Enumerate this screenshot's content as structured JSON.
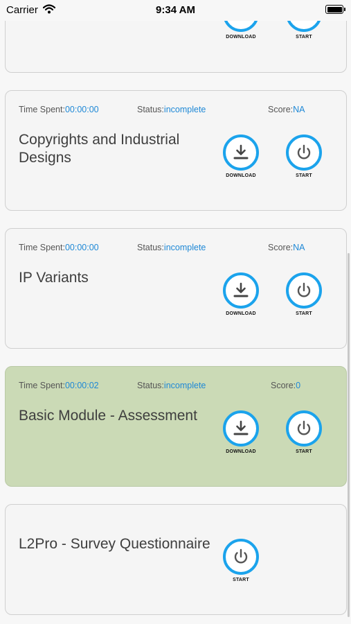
{
  "status_bar": {
    "carrier": "Carrier",
    "time": "9:34 AM"
  },
  "labels": {
    "time_spent": "Time Spent:",
    "status": "Status:",
    "score": "Score:",
    "download": "DOWNLOAD",
    "start": "START"
  },
  "modules": [
    {
      "title": "",
      "time_spent": "",
      "status": "",
      "score": ""
    },
    {
      "title": "Copyrights and Industrial Designs",
      "time_spent": "00:00:00",
      "status": "incomplete",
      "score": "NA"
    },
    {
      "title": "IP Variants",
      "time_spent": "00:00:00",
      "status": "incomplete",
      "score": "NA"
    },
    {
      "title": "Basic Module - Assessment",
      "time_spent": "00:00:02",
      "status": "incomplete",
      "score": "0"
    },
    {
      "title": "L2Pro - Survey Questionnaire"
    }
  ],
  "colors": {
    "accent": "#1ba3ec",
    "value_text": "#1e88d6",
    "highlight_card": "#cbdab6"
  },
  "icons": [
    "wifi-icon",
    "battery-icon",
    "download-icon",
    "power-icon"
  ]
}
